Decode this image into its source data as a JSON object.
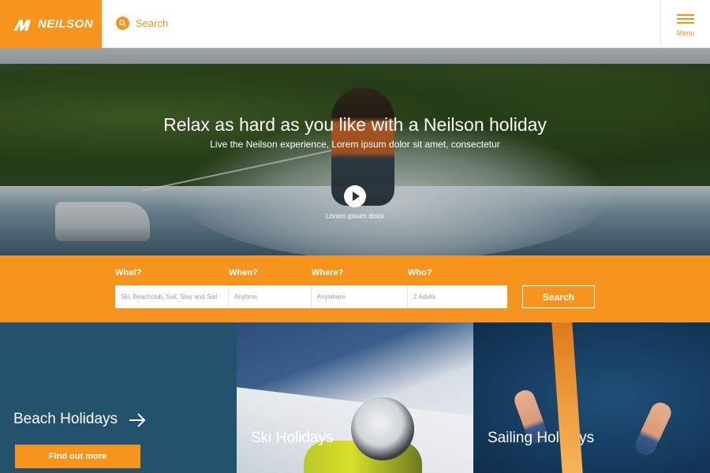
{
  "header": {
    "logo_text": "NEILSON",
    "search_label": "Search",
    "menu_label": "Menu"
  },
  "hero": {
    "title": "Relax as hard as you like with a Neilson holiday",
    "subtitle": "Live the Neilson experience, Lorem ipsum dolor sit amet, consectetur",
    "video_label": "Lorem ipsum dolor"
  },
  "searchbar": {
    "labels": {
      "what": "What?",
      "when": "When?",
      "where": "Where?",
      "who": "Who?"
    },
    "fields": {
      "what": "Ski, Beachclub, Sail, Stay and Sail",
      "when": "Anytime",
      "where": "Anywhere",
      "who": "2 Adults"
    },
    "button": "Search"
  },
  "tiles": {
    "beach": {
      "title": "Beach Holidays",
      "cta": "Find out more"
    },
    "ski": {
      "title": "Ski Holidays"
    },
    "sailing": {
      "title": "Sailing Holidays"
    }
  },
  "colors": {
    "brand_orange": "#f7941d",
    "beach_tile": "#23526d",
    "white": "#ffffff"
  }
}
